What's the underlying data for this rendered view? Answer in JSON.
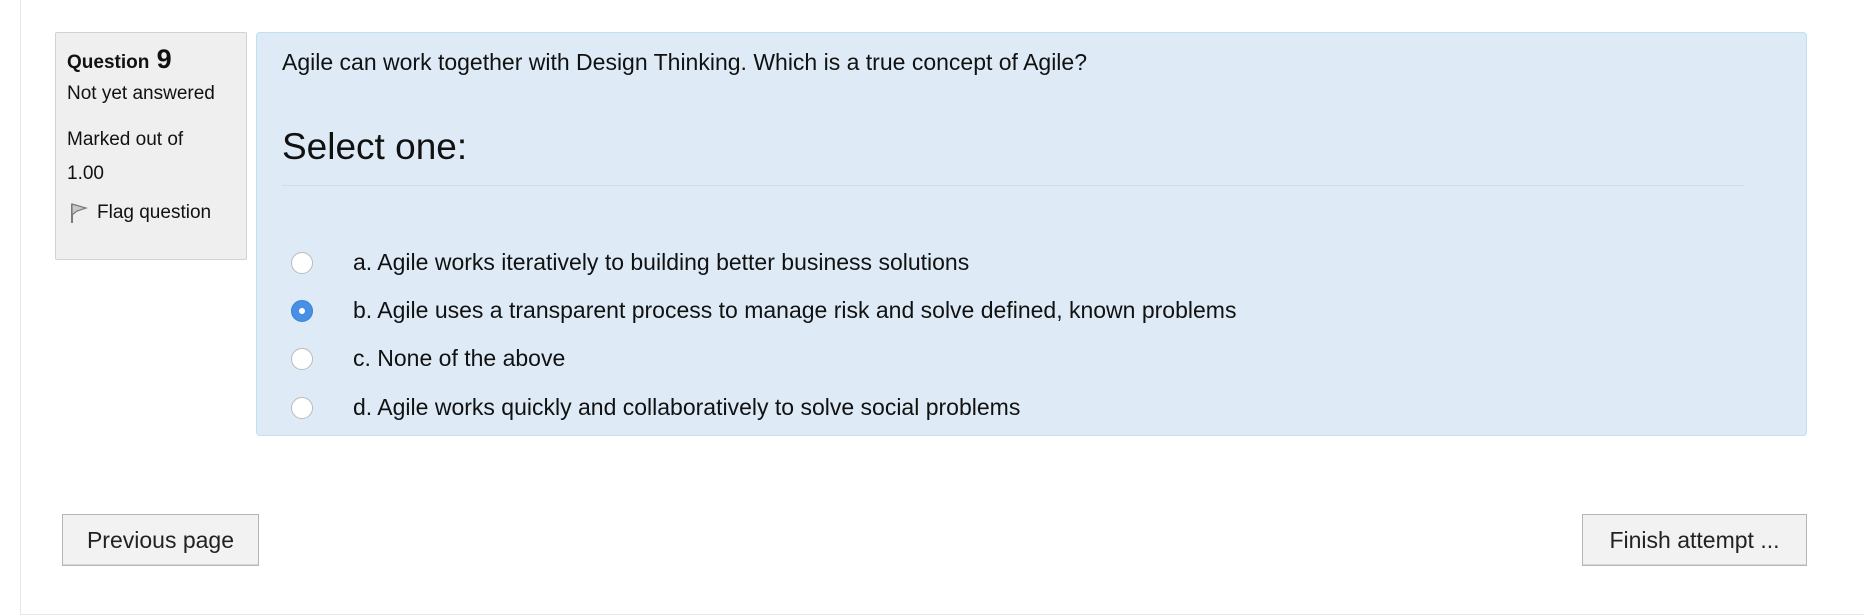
{
  "info": {
    "question_label": "Question",
    "question_number": "9",
    "status": "Not yet answered",
    "marked_line1": "Marked out of",
    "marked_line2": "1.00",
    "flag_label": "Flag question"
  },
  "question": {
    "text": "Agile can work together with Design Thinking. Which is a true concept of Agile?",
    "prompt": "Select one:",
    "selected_index": 1,
    "options": [
      {
        "label": "a. Agile works iteratively to building better business solutions",
        "checked": false
      },
      {
        "label": "b. Agile uses a transparent process to manage risk and solve defined, known problems",
        "checked": true
      },
      {
        "label": "c. None of the above",
        "checked": false
      },
      {
        "label": "d. Agile works quickly and collaboratively to solve social problems",
        "checked": false
      }
    ]
  },
  "navigation": {
    "previous_label": "Previous page",
    "finish_label": "Finish attempt ..."
  },
  "colors": {
    "question_bg": "#deebf6",
    "info_bg": "#efefef",
    "radio_selected": "#4a8fe6"
  }
}
